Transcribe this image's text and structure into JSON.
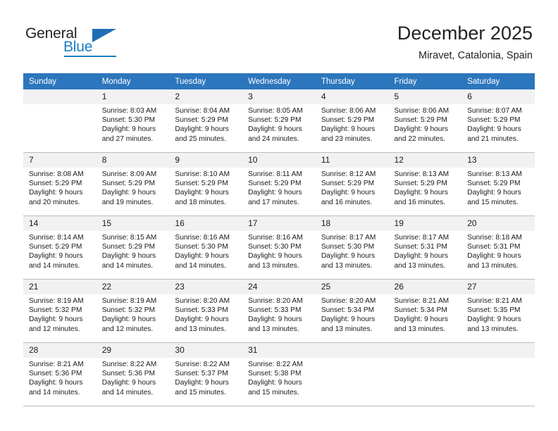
{
  "brand": {
    "name_top": "General",
    "name_bottom": "Blue",
    "accent_color": "#1a7dc4",
    "triangle_color": "#1f6eb5"
  },
  "header": {
    "title": "December 2025",
    "subtitle": "Miravet, Catalonia, Spain"
  },
  "calendar": {
    "header_color": "#2c76bd",
    "daynum_bg": "#f1f1f1",
    "weekday_headers": [
      "Sunday",
      "Monday",
      "Tuesday",
      "Wednesday",
      "Thursday",
      "Friday",
      "Saturday"
    ],
    "weeks": [
      [
        {
          "day": "",
          "lines": []
        },
        {
          "day": "1",
          "lines": [
            "Sunrise: 8:03 AM",
            "Sunset: 5:30 PM",
            "Daylight: 9 hours",
            "and 27 minutes."
          ]
        },
        {
          "day": "2",
          "lines": [
            "Sunrise: 8:04 AM",
            "Sunset: 5:29 PM",
            "Daylight: 9 hours",
            "and 25 minutes."
          ]
        },
        {
          "day": "3",
          "lines": [
            "Sunrise: 8:05 AM",
            "Sunset: 5:29 PM",
            "Daylight: 9 hours",
            "and 24 minutes."
          ]
        },
        {
          "day": "4",
          "lines": [
            "Sunrise: 8:06 AM",
            "Sunset: 5:29 PM",
            "Daylight: 9 hours",
            "and 23 minutes."
          ]
        },
        {
          "day": "5",
          "lines": [
            "Sunrise: 8:06 AM",
            "Sunset: 5:29 PM",
            "Daylight: 9 hours",
            "and 22 minutes."
          ]
        },
        {
          "day": "6",
          "lines": [
            "Sunrise: 8:07 AM",
            "Sunset: 5:29 PM",
            "Daylight: 9 hours",
            "and 21 minutes."
          ]
        }
      ],
      [
        {
          "day": "7",
          "lines": [
            "Sunrise: 8:08 AM",
            "Sunset: 5:29 PM",
            "Daylight: 9 hours",
            "and 20 minutes."
          ]
        },
        {
          "day": "8",
          "lines": [
            "Sunrise: 8:09 AM",
            "Sunset: 5:29 PM",
            "Daylight: 9 hours",
            "and 19 minutes."
          ]
        },
        {
          "day": "9",
          "lines": [
            "Sunrise: 8:10 AM",
            "Sunset: 5:29 PM",
            "Daylight: 9 hours",
            "and 18 minutes."
          ]
        },
        {
          "day": "10",
          "lines": [
            "Sunrise: 8:11 AM",
            "Sunset: 5:29 PM",
            "Daylight: 9 hours",
            "and 17 minutes."
          ]
        },
        {
          "day": "11",
          "lines": [
            "Sunrise: 8:12 AM",
            "Sunset: 5:29 PM",
            "Daylight: 9 hours",
            "and 16 minutes."
          ]
        },
        {
          "day": "12",
          "lines": [
            "Sunrise: 8:13 AM",
            "Sunset: 5:29 PM",
            "Daylight: 9 hours",
            "and 16 minutes."
          ]
        },
        {
          "day": "13",
          "lines": [
            "Sunrise: 8:13 AM",
            "Sunset: 5:29 PM",
            "Daylight: 9 hours",
            "and 15 minutes."
          ]
        }
      ],
      [
        {
          "day": "14",
          "lines": [
            "Sunrise: 8:14 AM",
            "Sunset: 5:29 PM",
            "Daylight: 9 hours",
            "and 14 minutes."
          ]
        },
        {
          "day": "15",
          "lines": [
            "Sunrise: 8:15 AM",
            "Sunset: 5:29 PM",
            "Daylight: 9 hours",
            "and 14 minutes."
          ]
        },
        {
          "day": "16",
          "lines": [
            "Sunrise: 8:16 AM",
            "Sunset: 5:30 PM",
            "Daylight: 9 hours",
            "and 14 minutes."
          ]
        },
        {
          "day": "17",
          "lines": [
            "Sunrise: 8:16 AM",
            "Sunset: 5:30 PM",
            "Daylight: 9 hours",
            "and 13 minutes."
          ]
        },
        {
          "day": "18",
          "lines": [
            "Sunrise: 8:17 AM",
            "Sunset: 5:30 PM",
            "Daylight: 9 hours",
            "and 13 minutes."
          ]
        },
        {
          "day": "19",
          "lines": [
            "Sunrise: 8:17 AM",
            "Sunset: 5:31 PM",
            "Daylight: 9 hours",
            "and 13 minutes."
          ]
        },
        {
          "day": "20",
          "lines": [
            "Sunrise: 8:18 AM",
            "Sunset: 5:31 PM",
            "Daylight: 9 hours",
            "and 13 minutes."
          ]
        }
      ],
      [
        {
          "day": "21",
          "lines": [
            "Sunrise: 8:19 AM",
            "Sunset: 5:32 PM",
            "Daylight: 9 hours",
            "and 12 minutes."
          ]
        },
        {
          "day": "22",
          "lines": [
            "Sunrise: 8:19 AM",
            "Sunset: 5:32 PM",
            "Daylight: 9 hours",
            "and 12 minutes."
          ]
        },
        {
          "day": "23",
          "lines": [
            "Sunrise: 8:20 AM",
            "Sunset: 5:33 PM",
            "Daylight: 9 hours",
            "and 13 minutes."
          ]
        },
        {
          "day": "24",
          "lines": [
            "Sunrise: 8:20 AM",
            "Sunset: 5:33 PM",
            "Daylight: 9 hours",
            "and 13 minutes."
          ]
        },
        {
          "day": "25",
          "lines": [
            "Sunrise: 8:20 AM",
            "Sunset: 5:34 PM",
            "Daylight: 9 hours",
            "and 13 minutes."
          ]
        },
        {
          "day": "26",
          "lines": [
            "Sunrise: 8:21 AM",
            "Sunset: 5:34 PM",
            "Daylight: 9 hours",
            "and 13 minutes."
          ]
        },
        {
          "day": "27",
          "lines": [
            "Sunrise: 8:21 AM",
            "Sunset: 5:35 PM",
            "Daylight: 9 hours",
            "and 13 minutes."
          ]
        }
      ],
      [
        {
          "day": "28",
          "lines": [
            "Sunrise: 8:21 AM",
            "Sunset: 5:36 PM",
            "Daylight: 9 hours",
            "and 14 minutes."
          ]
        },
        {
          "day": "29",
          "lines": [
            "Sunrise: 8:22 AM",
            "Sunset: 5:36 PM",
            "Daylight: 9 hours",
            "and 14 minutes."
          ]
        },
        {
          "day": "30",
          "lines": [
            "Sunrise: 8:22 AM",
            "Sunset: 5:37 PM",
            "Daylight: 9 hours",
            "and 15 minutes."
          ]
        },
        {
          "day": "31",
          "lines": [
            "Sunrise: 8:22 AM",
            "Sunset: 5:38 PM",
            "Daylight: 9 hours",
            "and 15 minutes."
          ]
        },
        {
          "day": "",
          "lines": []
        },
        {
          "day": "",
          "lines": []
        },
        {
          "day": "",
          "lines": []
        }
      ]
    ]
  }
}
